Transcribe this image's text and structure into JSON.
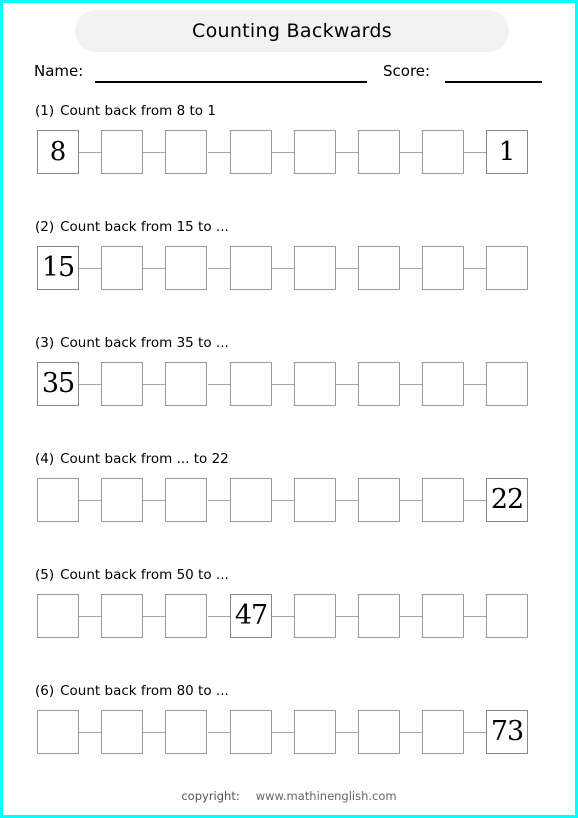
{
  "page": {
    "border_color": "#00ffff",
    "background": "#ffffff"
  },
  "header": {
    "title": "Counting Backwards",
    "banner_color": "#f2f2f2",
    "name_label": "Name:",
    "score_label": "Score:"
  },
  "exercises": [
    {
      "number": "(1)",
      "instruction": "Count back from 8 to 1",
      "cells": [
        "8",
        "",
        "",
        "",
        "",
        "",
        "",
        "1"
      ]
    },
    {
      "number": "(2)",
      "instruction": "Count back from 15 to ...",
      "cells": [
        "15",
        "",
        "",
        "",
        "",
        "",
        "",
        ""
      ]
    },
    {
      "number": "(3)",
      "instruction": "Count back from 35 to ...",
      "cells": [
        "35",
        "",
        "",
        "",
        "",
        "",
        "",
        ""
      ]
    },
    {
      "number": "(4)",
      "instruction": "Count back from ... to 22",
      "cells": [
        "",
        "",
        "",
        "",
        "",
        "",
        "",
        "22"
      ]
    },
    {
      "number": "(5)",
      "instruction": "Count back from 50 to ...",
      "cells": [
        "",
        "",
        "",
        "47",
        "",
        "",
        "",
        ""
      ]
    },
    {
      "number": "(6)",
      "instruction": "Count back from 80 to ...",
      "cells": [
        "",
        "",
        "",
        "",
        "",
        "",
        "",
        "73"
      ]
    }
  ],
  "footer": {
    "copyright_label": "copyright:",
    "url": "www.mathinenglish.com"
  }
}
